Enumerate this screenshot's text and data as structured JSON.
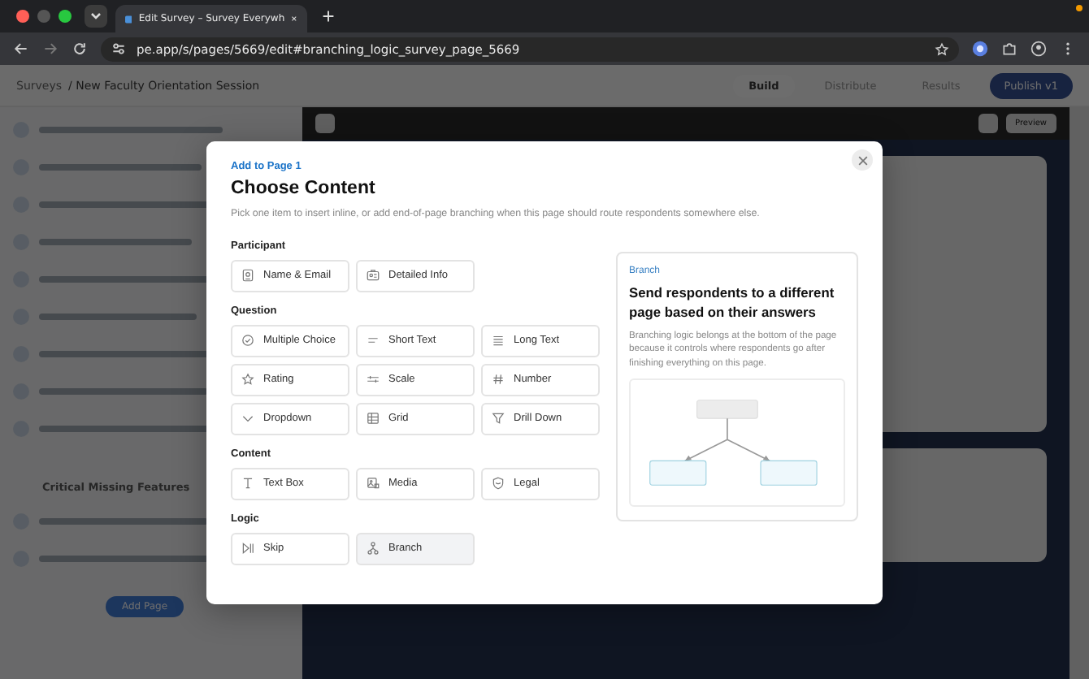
{
  "browser": {
    "tab_title": "Edit Survey – Survey Everywh",
    "url": "pe.app/s/pages/5669/edit#branching_logic_survey_page_5669"
  },
  "app_header": {
    "breadcrumb_root": "Surveys",
    "breadcrumb_current": "/ New Faculty Orientation Session",
    "tabs": [
      {
        "label": "Build",
        "selected": true
      },
      {
        "label": "Distribute",
        "selected": false
      },
      {
        "label": "Results",
        "selected": false
      }
    ],
    "publish": "Publish v1"
  },
  "canvas": {
    "preview": "Preview"
  },
  "sidebar": {
    "section_title": "Critical Missing Features",
    "add_page": "Add Page"
  },
  "modal": {
    "eyebrow": "Add to Page 1",
    "title": "Choose Content",
    "description": "Pick one item to insert inline, or add end-of-page branching when this page should route respondents somewhere else.",
    "sections": [
      {
        "title": "Participant",
        "items": [
          {
            "label": "Name & Email",
            "kind": "id",
            "selected": false
          },
          {
            "label": "Detailed Info",
            "kind": "card",
            "selected": false
          }
        ]
      },
      {
        "title": "Question",
        "items": [
          {
            "label": "Multiple Choice",
            "kind": "check",
            "selected": false
          },
          {
            "label": "Short Text",
            "kind": "short",
            "selected": false
          },
          {
            "label": "Long Text",
            "kind": "long",
            "selected": false
          },
          {
            "label": "Rating",
            "kind": "star",
            "selected": false
          },
          {
            "label": "Scale",
            "kind": "scale",
            "selected": false
          },
          {
            "label": "Number",
            "kind": "hash",
            "selected": false
          },
          {
            "label": "Dropdown",
            "kind": "chevron",
            "selected": false
          },
          {
            "label": "Grid",
            "kind": "grid",
            "selected": false
          },
          {
            "label": "Drill Down",
            "kind": "funnel",
            "selected": false
          }
        ]
      },
      {
        "title": "Content",
        "items": [
          {
            "label": "Text Box",
            "kind": "text",
            "selected": false
          },
          {
            "label": "Media",
            "kind": "image",
            "selected": false
          },
          {
            "label": "Legal",
            "kind": "shield",
            "selected": false
          }
        ]
      },
      {
        "title": "Logic",
        "items": [
          {
            "label": "Skip",
            "kind": "skip",
            "selected": false
          },
          {
            "label": "Branch",
            "kind": "branch",
            "selected": true
          }
        ]
      }
    ],
    "detail": {
      "eyebrow": "Branch",
      "title": "Send respondents to a different page based on their answers",
      "body": "Branching logic belongs at the bottom of the page because it controls where respondents go after finishing everything on this page."
    }
  }
}
